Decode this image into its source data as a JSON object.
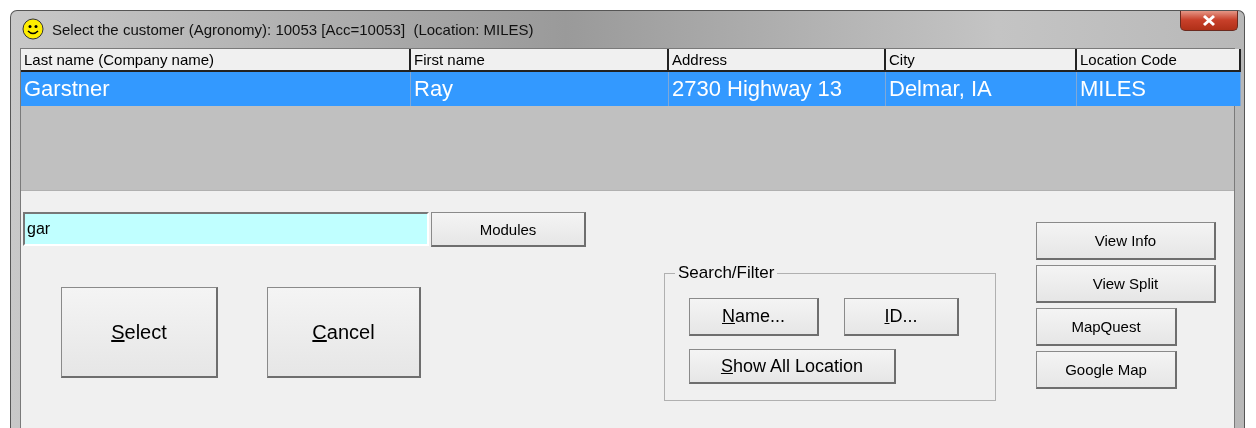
{
  "window": {
    "title": "Select the customer (Agronomy): 10053 [Acc=10053]  (Location: MILES)"
  },
  "table": {
    "columns": [
      "Last name (Company name)",
      "First name",
      "Address",
      "City",
      "Location Code"
    ],
    "rows": [
      {
        "cells": [
          "Garstner",
          "Ray",
          "2730 Highway 13",
          "Delmar, IA",
          "MILES"
        ],
        "selected": true
      }
    ]
  },
  "search_field": {
    "value": "gar"
  },
  "modules_button": {
    "label": "Modules",
    "underline_first": false
  },
  "action_buttons": [
    {
      "label": "Select",
      "underline_first": true
    },
    {
      "label": "Cancel",
      "underline_first": true
    }
  ],
  "search_filter": {
    "title": "Search/Filter",
    "buttons": [
      {
        "label": "Name...",
        "underline_first": true
      },
      {
        "label": "ID...",
        "underline_first": true
      },
      {
        "label": "Show All Location",
        "underline_first": true
      }
    ]
  },
  "side_buttons": [
    {
      "label": "View Info",
      "underline_first": false
    },
    {
      "label": "View Split",
      "underline_first": false
    },
    {
      "label": "MapQuest",
      "underline_first": false
    },
    {
      "label": "Google Map",
      "underline_first": false
    }
  ]
}
